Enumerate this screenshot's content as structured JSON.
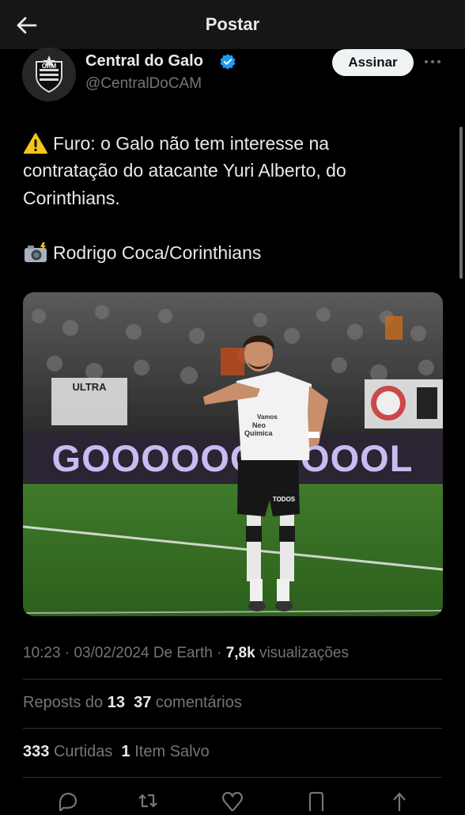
{
  "header": {
    "title": "Postar",
    "back_icon": "arrow-left-icon"
  },
  "author": {
    "name": "Central do Galo",
    "handle": "@CentralDoCAM",
    "verified_icon": "verified-badge-icon",
    "avatar_text": "CAM"
  },
  "follow_button": {
    "label": "Assinar"
  },
  "more_icon": "more-horizontal-icon",
  "tweet": {
    "warning_emoji": "⚠️",
    "line1": "Furo: o Galo não tem interesse na",
    "line2": "contratação do atacante Yuri Alberto, do",
    "line3": "Corinthians.",
    "camera_emoji": "📸",
    "credit": "Rodrigo Coca/Corinthians"
  },
  "photo": {
    "banner_text": "GOOOOOO OOOOL",
    "stand_text": "ULTRA",
    "sponsor_text_1": "Vamos",
    "sponsor_text_2": "Neo",
    "sponsor_text_3": "Química",
    "shorts_text": "TODOS"
  },
  "meta": {
    "time": "10:23",
    "separator": "·",
    "date": "03/02/2024",
    "source": "De Earth",
    "views_count": "7,8k",
    "views_label": "visualizações"
  },
  "stats": {
    "reposts_label": "Reposts do",
    "reposts_count": "13",
    "comments_count": "37",
    "comments_label": "comentários",
    "likes_count": "333",
    "likes_label": "Curtidas",
    "saves_count": "1",
    "saves_label": "Item Salvo"
  },
  "actions": [
    "reply-icon",
    "repost-icon",
    "like-icon",
    "bookmark-icon",
    "share-icon"
  ],
  "colors": {
    "background": "#000000",
    "header_bg": "#161616",
    "text": "#e7e9ea",
    "muted": "#71767b",
    "verified": "#1d9bf0",
    "divider": "#2f3336"
  }
}
